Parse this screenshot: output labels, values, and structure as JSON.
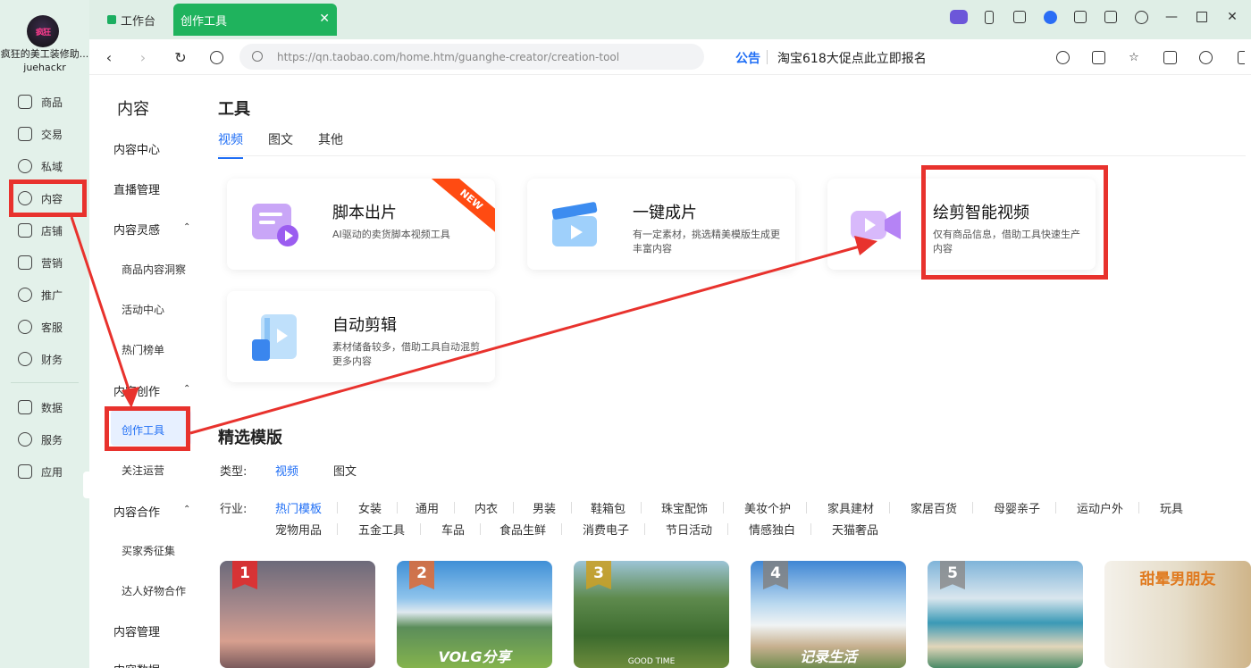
{
  "rail": {
    "store_name": "疯狂的美工装修助...",
    "user": "juehackr",
    "items": [
      {
        "label": "商品",
        "icon": "product-icon"
      },
      {
        "label": "交易",
        "icon": "trade-icon"
      },
      {
        "label": "私域",
        "icon": "private-domain-icon"
      },
      {
        "label": "内容",
        "icon": "content-icon"
      },
      {
        "label": "店铺",
        "icon": "store-icon"
      },
      {
        "label": "营销",
        "icon": "marketing-icon"
      },
      {
        "label": "推广",
        "icon": "promotion-icon"
      },
      {
        "label": "客服",
        "icon": "service-icon"
      },
      {
        "label": "财务",
        "icon": "finance-icon"
      },
      {
        "label": "数据",
        "icon": "data-icon"
      },
      {
        "label": "服务",
        "icon": "services-icon"
      },
      {
        "label": "应用",
        "icon": "apps-icon"
      }
    ]
  },
  "tabs_bar": {
    "home_tab": "工作台",
    "active_tab": "创作工具",
    "close": "✕"
  },
  "address": {
    "url": "https://qn.taobao.com/home.htm/guanghe-creator/creation-tool",
    "notice_label": "公告",
    "notice_text": "淘宝618大促点此立即报名"
  },
  "subnav": {
    "heading": "内容",
    "items": [
      {
        "label": "内容中心"
      },
      {
        "label": "直播管理"
      },
      {
        "label": "内容灵感",
        "caret": "⌃"
      },
      {
        "label": "商品内容洞察"
      },
      {
        "label": "活动中心"
      },
      {
        "label": "热门榜单"
      },
      {
        "label": "内容创作",
        "caret": "⌃"
      },
      {
        "label": "创作工具"
      },
      {
        "label": "关注运营"
      },
      {
        "label": "内容合作",
        "caret": "⌃"
      },
      {
        "label": "买家秀征集"
      },
      {
        "label": "达人好物合作"
      },
      {
        "label": "内容管理"
      },
      {
        "label": "内容数据"
      }
    ]
  },
  "main": {
    "title": "工具",
    "tabs": [
      "视频",
      "图文",
      "其他"
    ],
    "tools": [
      {
        "title": "脚本出片",
        "desc": "AI驱动的卖货脚本视频工具",
        "ribbon": "NEW"
      },
      {
        "title": "一键成片",
        "desc": "有一定素材，挑选精美模版生成更丰富内容"
      },
      {
        "title": "绘剪智能视频",
        "desc": "仅有商品信息，借助工具快速生产内容"
      },
      {
        "title": "自动剪辑",
        "desc": "素材储备较多，借助工具自动混剪更多内容"
      }
    ],
    "section_title": "精选模版",
    "type_label": "类型:",
    "types": [
      "视频",
      "图文"
    ],
    "industry_label": "行业:",
    "industries_row1": [
      "热门模板",
      "女装",
      "通用",
      "内衣",
      "男装",
      "鞋箱包",
      "珠宝配饰",
      "美妆个护",
      "家具建材",
      "家居百货",
      "母婴亲子",
      "运动户外",
      "玩具"
    ],
    "industries_row2": [
      "宠物用品",
      "五金工具",
      "车品",
      "食品生鲜",
      "消费电子",
      "节日活动",
      "情感独白",
      "天猫奢品"
    ],
    "templates": [
      {
        "rank": "1",
        "caption": ""
      },
      {
        "rank": "2",
        "caption": "VOLG分享"
      },
      {
        "rank": "3",
        "caption": "GOOD TIME"
      },
      {
        "rank": "4",
        "caption": "记录生活"
      },
      {
        "rank": "5",
        "caption": ""
      },
      {
        "rank": "",
        "caption": "甜晕男朋友"
      }
    ]
  },
  "colors": {
    "accent": "#1f6ef5",
    "tab_green": "#1fb35d",
    "annotation_red": "#e8322d",
    "rail_bg": "#e3f1ea"
  }
}
